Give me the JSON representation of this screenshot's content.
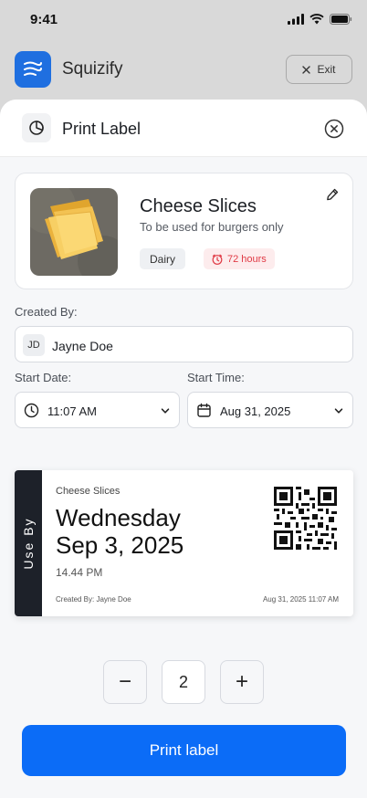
{
  "status_bar": {
    "time": "9:41"
  },
  "app": {
    "name": "Squizify",
    "exit_label": "Exit"
  },
  "sheet": {
    "title": "Print Label",
    "product": {
      "name": "Cheese Slices",
      "description": "To be used for burgers only",
      "category_tag": "Dairy",
      "shelf_life_tag": "72 hours"
    },
    "created_by": {
      "label": "Created By:",
      "initials": "JD",
      "name": "Jayne Doe"
    },
    "start_date": {
      "label": "Start Date:",
      "value": "11:07 AM"
    },
    "start_time": {
      "label": "Start Time:",
      "value": "Aug 31, 2025"
    },
    "preview": {
      "band_text": "Use By",
      "product": "Cheese Slices",
      "day": "Wednesday",
      "date": "Sep 3, 2025",
      "time": "14.44 PM",
      "created_by": "Created By: Jayne Doe",
      "created_at": "Aug 31, 2025  11:07 AM"
    },
    "quantity": {
      "decrement": "−",
      "value": "2",
      "increment": "+"
    },
    "print_label": "Print label"
  },
  "colors": {
    "accent": "#0b6cf7",
    "logo": "#1f6fe0",
    "band": "#1d2129",
    "shelf_life": "#e03a45"
  },
  "icons": {
    "logo": "waves-logo-icon",
    "sheet": "pie-chart-icon",
    "close": "close-circle-icon",
    "edit": "pencil-icon",
    "timer": "timer-icon",
    "clock": "clock-icon",
    "calendar": "calendar-icon",
    "caret": "chevron-down-icon",
    "exit": "close-icon"
  }
}
